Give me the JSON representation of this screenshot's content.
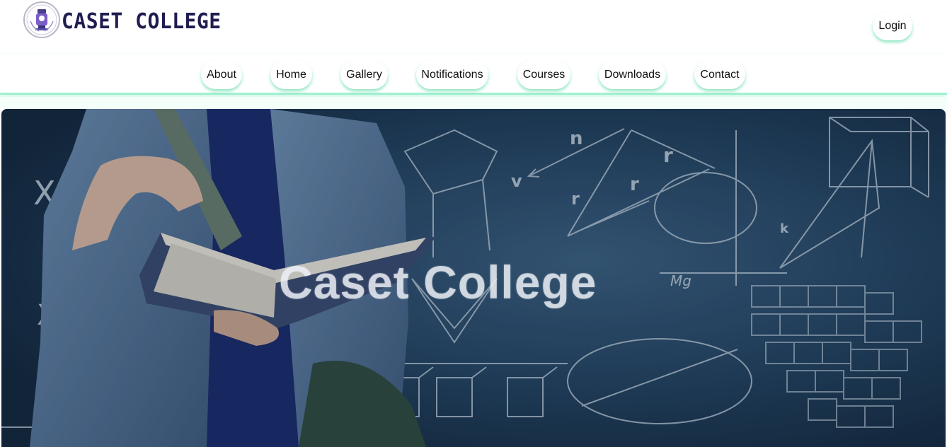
{
  "brand": {
    "name": "CASET COLLEGE",
    "logo_icon": "college-crest-icon"
  },
  "header": {
    "login_label": "Login"
  },
  "nav": {
    "items": [
      {
        "label": "About"
      },
      {
        "label": "Home"
      },
      {
        "label": "Gallery"
      },
      {
        "label": "Notifications"
      },
      {
        "label": "Courses"
      },
      {
        "label": "Downloads"
      },
      {
        "label": "Contact"
      }
    ]
  },
  "hero": {
    "title": "Caset College",
    "background": "student-reading-book-chalkboard-math-image"
  },
  "colors": {
    "brand_text": "#1f1d4f",
    "accent_glow": "#9ff0cf",
    "hero_bg": "#1c3650"
  }
}
